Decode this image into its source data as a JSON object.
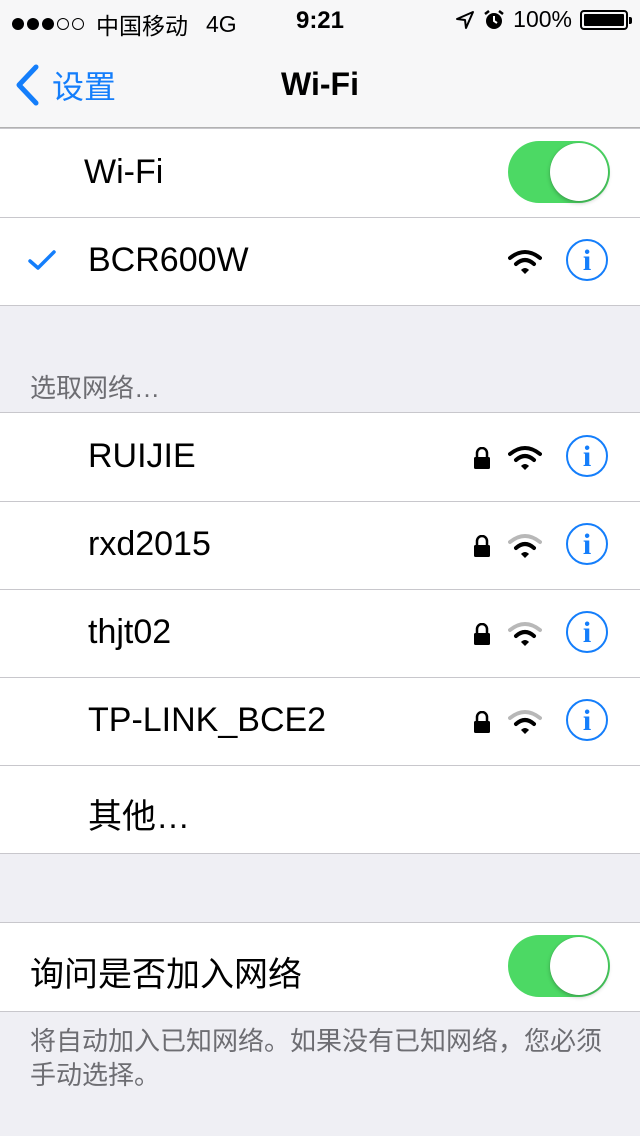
{
  "status_bar": {
    "carrier": "中国移动",
    "network": "4G",
    "time": "9:21",
    "battery": "100%"
  },
  "nav": {
    "back_label": "设置",
    "title": "Wi-Fi"
  },
  "wifi_toggle": {
    "label": "Wi-Fi",
    "on": true
  },
  "connected": {
    "name": "BCR600W"
  },
  "section_header": "选取网络…",
  "networks": [
    {
      "name": "RUIJIE"
    },
    {
      "name": "rxd2015"
    },
    {
      "name": "thjt02"
    },
    {
      "name": "TP-LINK_BCE2"
    }
  ],
  "other_label": "其他…",
  "ask_join": {
    "label": "询问是否加入网络",
    "on": true
  },
  "footer_note": "将自动加入已知网络。如果没有已知网络，您必须手动选择。",
  "colors": {
    "accent": "#147efb",
    "toggle_on": "#4cd964",
    "background": "#efeff4"
  },
  "icons": {
    "check": "check-icon",
    "wifi": "wifi-icon",
    "lock": "lock-icon",
    "info": "info-icon",
    "back": "chevron-left-icon"
  }
}
